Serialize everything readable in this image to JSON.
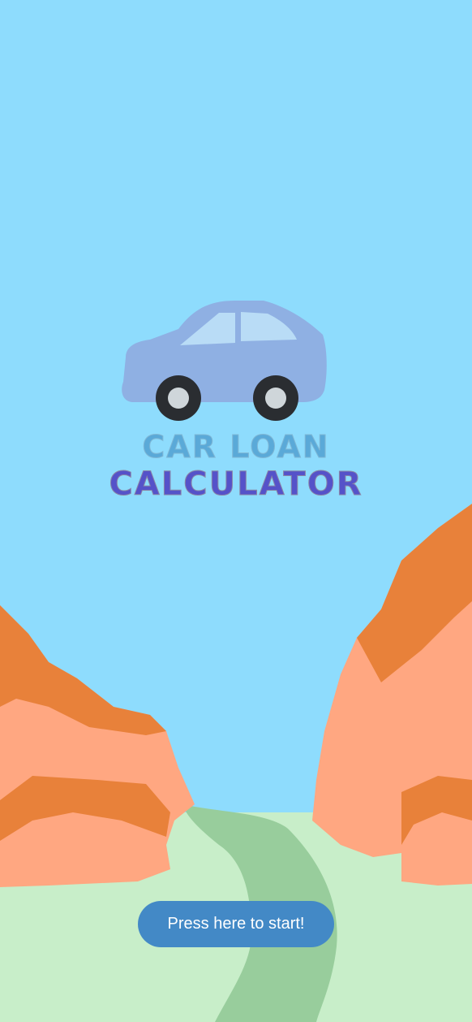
{
  "logo": {
    "line1": "CAR LOAN",
    "line2": "CALCULATOR",
    "line1_color": "#5aa9d8",
    "line2_color": "#5552c9",
    "car_body_color": "#8fb0e3",
    "car_window_color": "#b9dcf6",
    "wheel_color": "#2a2d31",
    "hub_color": "#cfd6da"
  },
  "start_button": {
    "label": "Press here to start!",
    "color": "#4389c6"
  },
  "scene": {
    "sky_color": "#8edcfd",
    "grass_color": "#c8eec9",
    "road_color": "#98cd9c",
    "rock_light_color": "#ffa781",
    "rock_dark_color": "#e8813a"
  }
}
